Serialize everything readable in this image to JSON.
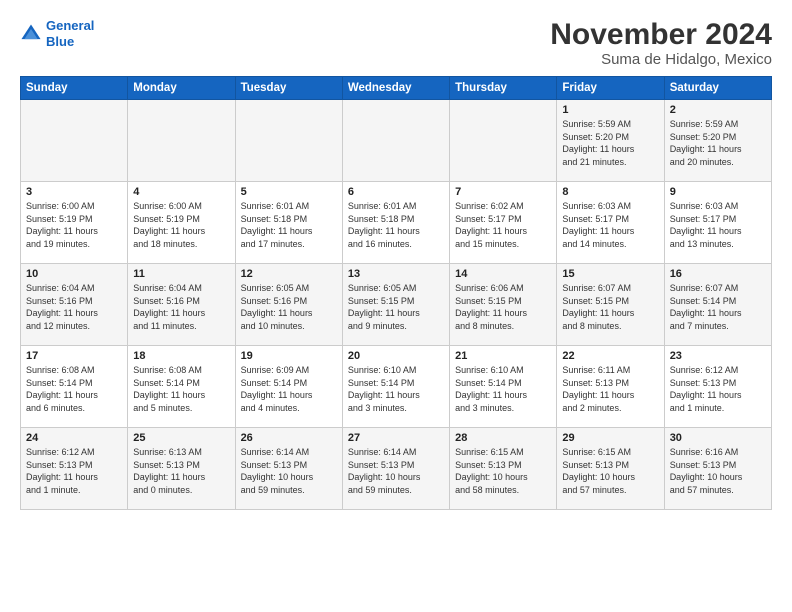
{
  "logo": {
    "line1": "General",
    "line2": "Blue"
  },
  "title": "November 2024",
  "subtitle": "Suma de Hidalgo, Mexico",
  "columns": [
    "Sunday",
    "Monday",
    "Tuesday",
    "Wednesday",
    "Thursday",
    "Friday",
    "Saturday"
  ],
  "weeks": [
    {
      "days": [
        {
          "num": "",
          "info": ""
        },
        {
          "num": "",
          "info": ""
        },
        {
          "num": "",
          "info": ""
        },
        {
          "num": "",
          "info": ""
        },
        {
          "num": "",
          "info": ""
        },
        {
          "num": "1",
          "info": "Sunrise: 5:59 AM\nSunset: 5:20 PM\nDaylight: 11 hours\nand 21 minutes."
        },
        {
          "num": "2",
          "info": "Sunrise: 5:59 AM\nSunset: 5:20 PM\nDaylight: 11 hours\nand 20 minutes."
        }
      ]
    },
    {
      "days": [
        {
          "num": "3",
          "info": "Sunrise: 6:00 AM\nSunset: 5:19 PM\nDaylight: 11 hours\nand 19 minutes."
        },
        {
          "num": "4",
          "info": "Sunrise: 6:00 AM\nSunset: 5:19 PM\nDaylight: 11 hours\nand 18 minutes."
        },
        {
          "num": "5",
          "info": "Sunrise: 6:01 AM\nSunset: 5:18 PM\nDaylight: 11 hours\nand 17 minutes."
        },
        {
          "num": "6",
          "info": "Sunrise: 6:01 AM\nSunset: 5:18 PM\nDaylight: 11 hours\nand 16 minutes."
        },
        {
          "num": "7",
          "info": "Sunrise: 6:02 AM\nSunset: 5:17 PM\nDaylight: 11 hours\nand 15 minutes."
        },
        {
          "num": "8",
          "info": "Sunrise: 6:03 AM\nSunset: 5:17 PM\nDaylight: 11 hours\nand 14 minutes."
        },
        {
          "num": "9",
          "info": "Sunrise: 6:03 AM\nSunset: 5:17 PM\nDaylight: 11 hours\nand 13 minutes."
        }
      ]
    },
    {
      "days": [
        {
          "num": "10",
          "info": "Sunrise: 6:04 AM\nSunset: 5:16 PM\nDaylight: 11 hours\nand 12 minutes."
        },
        {
          "num": "11",
          "info": "Sunrise: 6:04 AM\nSunset: 5:16 PM\nDaylight: 11 hours\nand 11 minutes."
        },
        {
          "num": "12",
          "info": "Sunrise: 6:05 AM\nSunset: 5:16 PM\nDaylight: 11 hours\nand 10 minutes."
        },
        {
          "num": "13",
          "info": "Sunrise: 6:05 AM\nSunset: 5:15 PM\nDaylight: 11 hours\nand 9 minutes."
        },
        {
          "num": "14",
          "info": "Sunrise: 6:06 AM\nSunset: 5:15 PM\nDaylight: 11 hours\nand 8 minutes."
        },
        {
          "num": "15",
          "info": "Sunrise: 6:07 AM\nSunset: 5:15 PM\nDaylight: 11 hours\nand 8 minutes."
        },
        {
          "num": "16",
          "info": "Sunrise: 6:07 AM\nSunset: 5:14 PM\nDaylight: 11 hours\nand 7 minutes."
        }
      ]
    },
    {
      "days": [
        {
          "num": "17",
          "info": "Sunrise: 6:08 AM\nSunset: 5:14 PM\nDaylight: 11 hours\nand 6 minutes."
        },
        {
          "num": "18",
          "info": "Sunrise: 6:08 AM\nSunset: 5:14 PM\nDaylight: 11 hours\nand 5 minutes."
        },
        {
          "num": "19",
          "info": "Sunrise: 6:09 AM\nSunset: 5:14 PM\nDaylight: 11 hours\nand 4 minutes."
        },
        {
          "num": "20",
          "info": "Sunrise: 6:10 AM\nSunset: 5:14 PM\nDaylight: 11 hours\nand 3 minutes."
        },
        {
          "num": "21",
          "info": "Sunrise: 6:10 AM\nSunset: 5:14 PM\nDaylight: 11 hours\nand 3 minutes."
        },
        {
          "num": "22",
          "info": "Sunrise: 6:11 AM\nSunset: 5:13 PM\nDaylight: 11 hours\nand 2 minutes."
        },
        {
          "num": "23",
          "info": "Sunrise: 6:12 AM\nSunset: 5:13 PM\nDaylight: 11 hours\nand 1 minute."
        }
      ]
    },
    {
      "days": [
        {
          "num": "24",
          "info": "Sunrise: 6:12 AM\nSunset: 5:13 PM\nDaylight: 11 hours\nand 1 minute."
        },
        {
          "num": "25",
          "info": "Sunrise: 6:13 AM\nSunset: 5:13 PM\nDaylight: 11 hours\nand 0 minutes."
        },
        {
          "num": "26",
          "info": "Sunrise: 6:14 AM\nSunset: 5:13 PM\nDaylight: 10 hours\nand 59 minutes."
        },
        {
          "num": "27",
          "info": "Sunrise: 6:14 AM\nSunset: 5:13 PM\nDaylight: 10 hours\nand 59 minutes."
        },
        {
          "num": "28",
          "info": "Sunrise: 6:15 AM\nSunset: 5:13 PM\nDaylight: 10 hours\nand 58 minutes."
        },
        {
          "num": "29",
          "info": "Sunrise: 6:15 AM\nSunset: 5:13 PM\nDaylight: 10 hours\nand 57 minutes."
        },
        {
          "num": "30",
          "info": "Sunrise: 6:16 AM\nSunset: 5:13 PM\nDaylight: 10 hours\nand 57 minutes."
        }
      ]
    }
  ]
}
